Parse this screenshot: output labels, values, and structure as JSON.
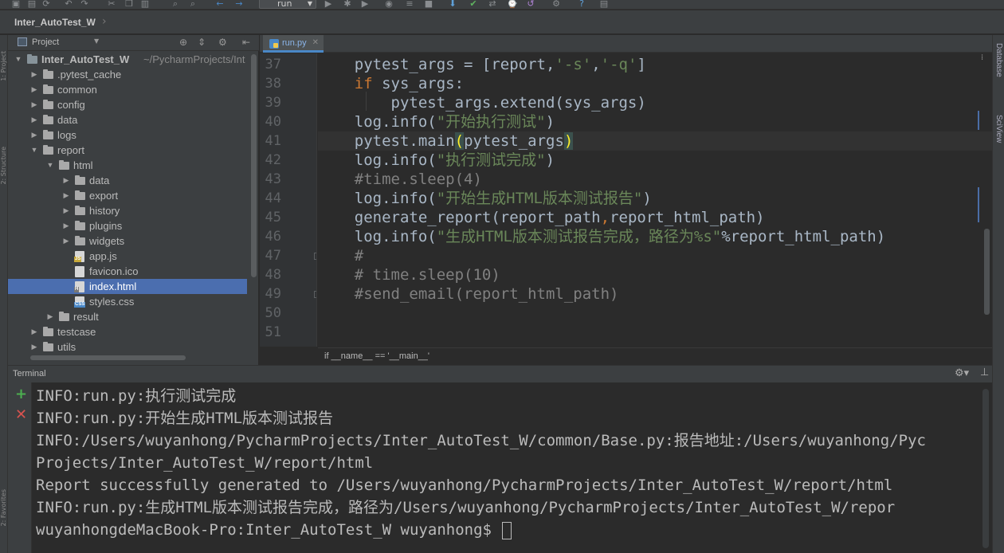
{
  "window": {
    "project_name": "Inter_AutoTest_W",
    "run_config": "run"
  },
  "left_strip": {
    "labels": [
      "1: Project",
      "2: Structure",
      "2: Favorites"
    ]
  },
  "right_strip": {
    "labels": [
      "Database",
      "SciView"
    ]
  },
  "project_panel": {
    "title": "Project",
    "tree": [
      {
        "label": "Inter_AutoTest_W",
        "path": "~/PycharmProjects/Int",
        "depth": 0,
        "type": "folder-root",
        "expanded": true
      },
      {
        "label": ".pytest_cache",
        "depth": 1,
        "type": "folder",
        "expanded": false
      },
      {
        "label": "common",
        "depth": 1,
        "type": "folder",
        "expanded": false
      },
      {
        "label": "config",
        "depth": 1,
        "type": "folder",
        "expanded": false
      },
      {
        "label": "data",
        "depth": 1,
        "type": "folder",
        "expanded": false
      },
      {
        "label": "logs",
        "depth": 1,
        "type": "folder",
        "expanded": false
      },
      {
        "label": "report",
        "depth": 1,
        "type": "folder",
        "expanded": true
      },
      {
        "label": "html",
        "depth": 2,
        "type": "folder",
        "expanded": true
      },
      {
        "label": "data",
        "depth": 3,
        "type": "folder",
        "expanded": false
      },
      {
        "label": "export",
        "depth": 3,
        "type": "folder",
        "expanded": false
      },
      {
        "label": "history",
        "depth": 3,
        "type": "folder",
        "expanded": false
      },
      {
        "label": "plugins",
        "depth": 3,
        "type": "folder",
        "expanded": false
      },
      {
        "label": "widgets",
        "depth": 3,
        "type": "folder",
        "expanded": false
      },
      {
        "label": "app.js",
        "depth": 3,
        "type": "file-js"
      },
      {
        "label": "favicon.ico",
        "depth": 3,
        "type": "file"
      },
      {
        "label": "index.html",
        "depth": 3,
        "type": "file-html",
        "selected": true
      },
      {
        "label": "styles.css",
        "depth": 3,
        "type": "file-css"
      },
      {
        "label": "result",
        "depth": 2,
        "type": "folder",
        "expanded": false
      },
      {
        "label": "testcase",
        "depth": 1,
        "type": "folder",
        "expanded": false
      },
      {
        "label": "utils",
        "depth": 1,
        "type": "folder",
        "expanded": false
      }
    ]
  },
  "editor": {
    "tab_label": "run.py",
    "line_numbers": [
      "37",
      "38",
      "39",
      "40",
      "41",
      "42",
      "43",
      "44",
      "45",
      "46",
      "47",
      "48",
      "49",
      "50",
      "51"
    ],
    "lines": [
      {
        "indent": "    ",
        "parts": [
          {
            "t": "pytest_args = [report,",
            "c": ""
          },
          {
            "t": "'-s'",
            "c": "str"
          },
          {
            "t": ",",
            "c": ""
          },
          {
            "t": "'-q'",
            "c": "str"
          },
          {
            "t": "]",
            "c": ""
          }
        ]
      },
      {
        "indent": "    ",
        "parts": [
          {
            "t": "if",
            "c": "kw"
          },
          {
            "t": " sys_args:",
            "c": ""
          }
        ]
      },
      {
        "indent": "        ",
        "parts": [
          {
            "t": "pytest_args.extend(sys_args)",
            "c": ""
          }
        ]
      },
      {
        "indent": "    ",
        "parts": [
          {
            "t": "log.info(",
            "c": ""
          },
          {
            "t": "\"开始执行测试\"",
            "c": "str"
          },
          {
            "t": ")",
            "c": ""
          }
        ]
      },
      {
        "indent": "    ",
        "current": true,
        "parts": [
          {
            "t": "pytest.main",
            "c": ""
          },
          {
            "t": "(",
            "c": "bracket"
          },
          {
            "t": "pytest_args",
            "c": ""
          },
          {
            "t": ")",
            "c": "bracket"
          }
        ]
      },
      {
        "indent": "    ",
        "parts": [
          {
            "t": "log.info(",
            "c": ""
          },
          {
            "t": "\"执行测试完成\"",
            "c": "str"
          },
          {
            "t": ")",
            "c": ""
          }
        ]
      },
      {
        "indent": "    ",
        "parts": [
          {
            "t": "#time.sleep(4)",
            "c": "cm"
          }
        ]
      },
      {
        "indent": "    ",
        "parts": [
          {
            "t": "log.info(",
            "c": ""
          },
          {
            "t": "\"开始生成HTML版本测试报告\"",
            "c": "str"
          },
          {
            "t": ")",
            "c": ""
          }
        ]
      },
      {
        "indent": "    ",
        "parts": [
          {
            "t": "generate_report(report_path",
            "c": ""
          },
          {
            "t": ",",
            "c": "kw"
          },
          {
            "t": "report_html_path)",
            "c": ""
          }
        ]
      },
      {
        "indent": "    ",
        "parts": [
          {
            "t": "log.info(",
            "c": ""
          },
          {
            "t": "\"生成HTML版本测试报告完成，路径为%s\"",
            "c": "str"
          },
          {
            "t": "%report_html_path)",
            "c": ""
          }
        ]
      },
      {
        "indent": "    ",
        "parts": [
          {
            "t": "#",
            "c": "cm"
          }
        ]
      },
      {
        "indent": "    ",
        "parts": [
          {
            "t": "# time.sleep(10)",
            "c": "cm"
          }
        ]
      },
      {
        "indent": "    ",
        "parts": [
          {
            "t": "#send_email(report_html_path)",
            "c": "cm"
          }
        ]
      },
      {
        "indent": "",
        "parts": []
      },
      {
        "indent": "",
        "parts": []
      }
    ],
    "breadcrumb": "if __name__ == '__main__'"
  },
  "terminal": {
    "title": "Terminal",
    "lines": [
      "INFO:run.py:执行测试完成",
      "INFO:run.py:开始生成HTML版本测试报告",
      "INFO:/Users/wuyanhong/PycharmProjects/Inter_AutoTest_W/common/Base.py:报告地址:/Users/wuyanhong/Pyc",
      "Projects/Inter_AutoTest_W/report/html",
      "Report successfully generated to /Users/wuyanhong/PycharmProjects/Inter_AutoTest_W/report/html",
      "INFO:run.py:生成HTML版本测试报告完成，路径为/Users/wuyanhong/PycharmProjects/Inter_AutoTest_W/repor"
    ],
    "prompt": "wuyanhongdeMacBook-Pro:Inter_AutoTest_W wuyanhong$ "
  }
}
